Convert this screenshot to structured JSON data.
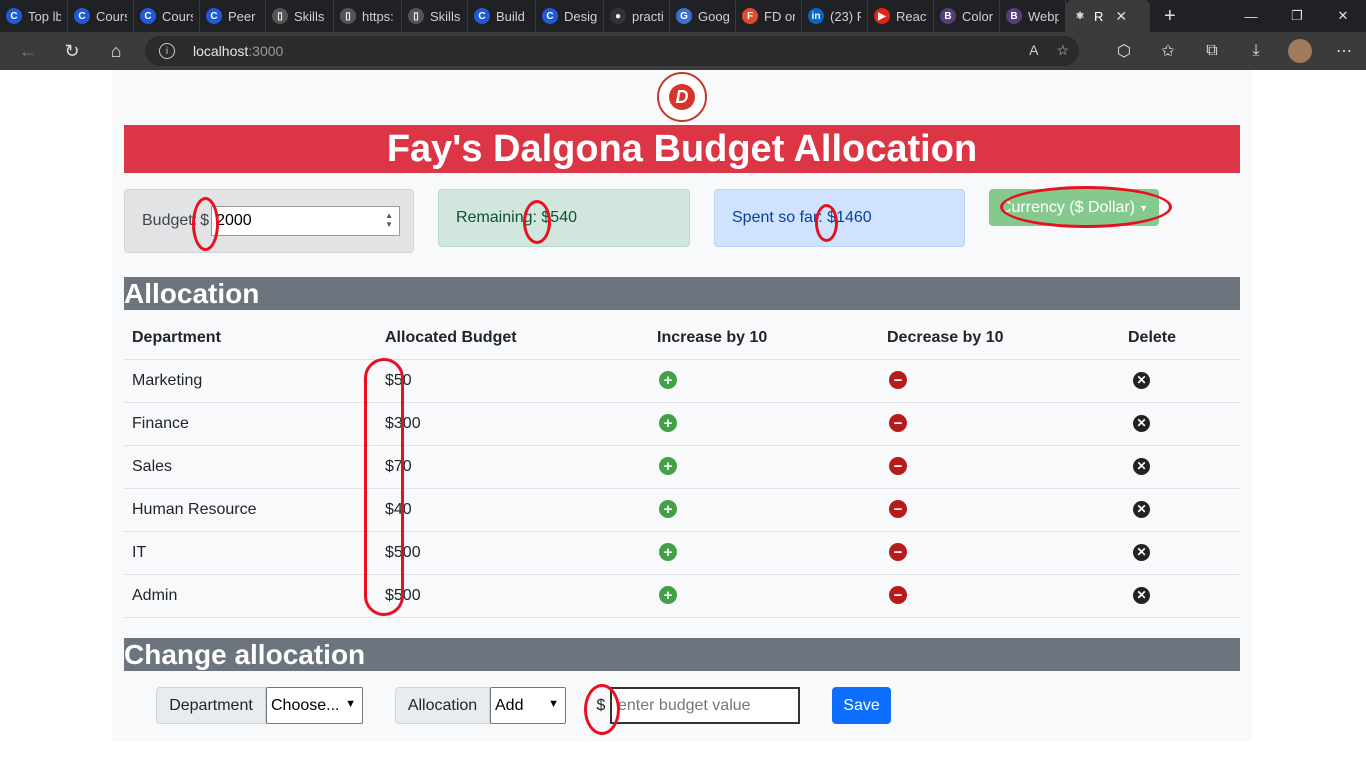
{
  "browser": {
    "tabs": [
      {
        "label": "Top lb",
        "icon": "C",
        "color": "#1f5bd6"
      },
      {
        "label": "Cours",
        "icon": "C",
        "color": "#1f5bd6"
      },
      {
        "label": "Cours",
        "icon": "C",
        "color": "#1f5bd6"
      },
      {
        "label": "Peer (",
        "icon": "C",
        "color": "#1f5bd6"
      },
      {
        "label": "Skills",
        "icon": "doc",
        "color": "#555555"
      },
      {
        "label": "https:",
        "icon": "doc",
        "color": "#555555"
      },
      {
        "label": "Skills",
        "icon": "doc",
        "color": "#555555"
      },
      {
        "label": "Build",
        "icon": "C",
        "color": "#1f5bd6"
      },
      {
        "label": "Desig",
        "icon": "C",
        "color": "#1f5bd6"
      },
      {
        "label": "practi",
        "icon": "github",
        "color": "#333333"
      },
      {
        "label": "Goog",
        "icon": "G",
        "color": "#3c6fd0"
      },
      {
        "label": "FD or",
        "icon": "F",
        "color": "#e14a2b"
      },
      {
        "label": "(23) F",
        "icon": "in",
        "color": "#0a66c2"
      },
      {
        "label": "React",
        "icon": "▶",
        "color": "#e62117"
      },
      {
        "label": "Color",
        "icon": "B",
        "color": "#563d7c"
      },
      {
        "label": "Webp",
        "icon": "B",
        "color": "#563d7c"
      },
      {
        "label": "R",
        "icon": "⚛",
        "color": "#3b3b3b"
      }
    ],
    "url_host": "localhost",
    "url_port": ":3000"
  },
  "page": {
    "title": "Fay's Dalgona Budget Allocation",
    "budget": {
      "label": "Budget:",
      "prefix": "$",
      "value": "2000"
    },
    "remaining": {
      "label": "Remaining:",
      "value": "$540"
    },
    "spent": {
      "label": "Spent so far:",
      "value": "$1460"
    },
    "currency": {
      "label": "Currency ($ Dollar)"
    },
    "allocation_heading": "Allocation",
    "table": {
      "headers": [
        "Department",
        "Allocated Budget",
        "Increase by 10",
        "Decrease by 10",
        "Delete"
      ],
      "rows": [
        {
          "department": "Marketing",
          "budget": "$50"
        },
        {
          "department": "Finance",
          "budget": "$300"
        },
        {
          "department": "Sales",
          "budget": "$70"
        },
        {
          "department": "Human Resource",
          "budget": "$40"
        },
        {
          "department": "IT",
          "budget": "$500"
        },
        {
          "department": "Admin",
          "budget": "$500"
        }
      ]
    },
    "change_heading": "Change allocation",
    "change": {
      "department_label": "Department",
      "department_selected": "Choose...",
      "allocation_label": "Allocation",
      "allocation_selected": "Add",
      "currency_symbol": "$",
      "value_placeholder": "enter budget value",
      "save_label": "Save"
    }
  }
}
